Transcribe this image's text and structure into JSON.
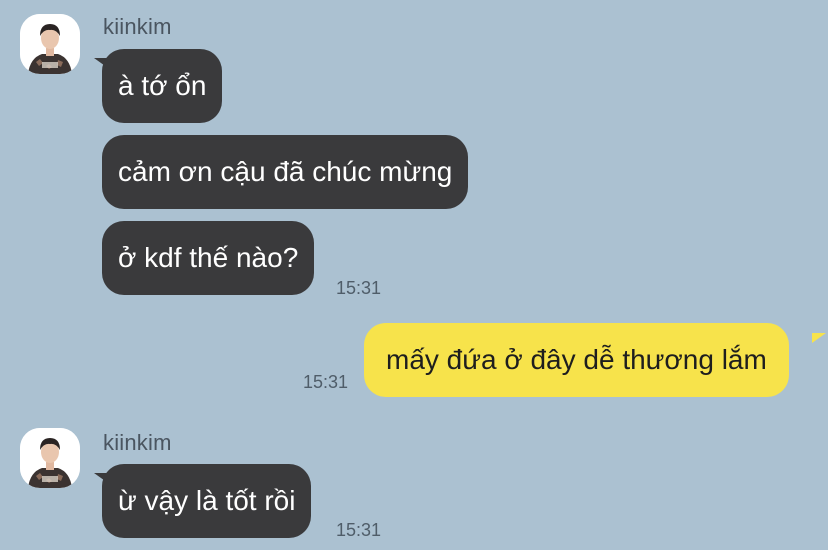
{
  "colors": {
    "background": "#abc1d1",
    "incoming_bubble": "#3a3a3c",
    "outgoing_bubble": "#f7e34b"
  },
  "messages": [
    {
      "sender": "kiinkim",
      "avatar": "profile-photo",
      "text": "à tớ ổn",
      "time": ""
    },
    {
      "sender": "kiinkim",
      "text": "cảm ơn cậu đã chúc mừng",
      "time": ""
    },
    {
      "sender": "kiinkim",
      "text": "ở kdf thế nào?",
      "time": "15:31"
    },
    {
      "sender": "me",
      "text": "mấy đứa ở đây dễ thương lắm",
      "time": "15:31"
    },
    {
      "sender": "kiinkim",
      "avatar": "profile-photo",
      "text": "ừ vậy là tốt rồi",
      "time": "15:31"
    }
  ]
}
